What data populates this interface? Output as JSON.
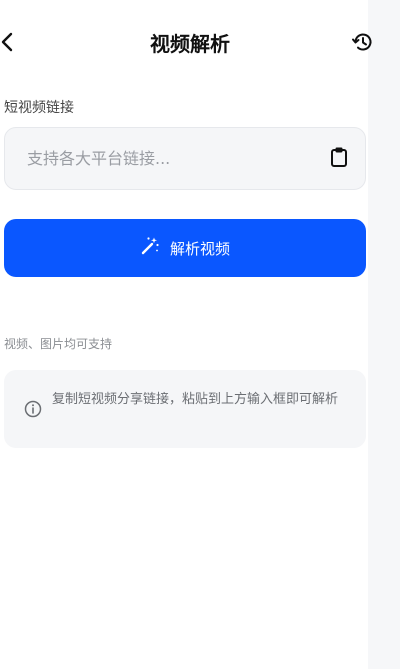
{
  "header": {
    "title": "视频解析",
    "back_icon": "chevron-left-icon",
    "history_icon": "history-icon"
  },
  "link_field": {
    "label": "短视频链接",
    "value": "",
    "placeholder": "支持各大平台链接...",
    "paste_icon": "clipboard-icon"
  },
  "parse_button": {
    "label": "解析视频",
    "icon": "magic-wand-icon",
    "color": "#0a57ff"
  },
  "support_text": "视频、图片均可支持",
  "tip": {
    "icon": "info-icon",
    "text": "复制短视频分享链接，粘贴到上方输入框即可解析"
  }
}
